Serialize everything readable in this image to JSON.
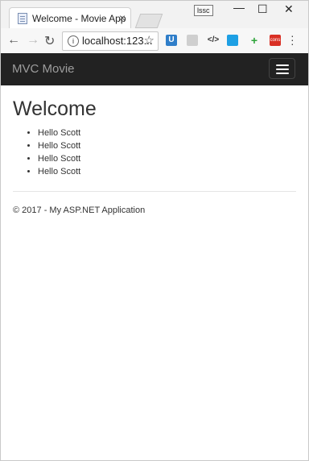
{
  "browser": {
    "tab_title": "Welcome - Movie App",
    "tab_close": "×",
    "user_badge": "lssc",
    "window_min": "—",
    "window_max": "☐",
    "window_close": "✕",
    "url": "localhost:123...",
    "info_glyph": "i",
    "star_glyph": "☆",
    "nav_back": "←",
    "nav_forward": "→",
    "nav_reload": "↻",
    "extensions": {
      "ext1": "U",
      "ext3": "</>",
      "ext5": "+",
      "ext6": "cons"
    }
  },
  "navbar": {
    "brand": "MVC Movie"
  },
  "main": {
    "heading": "Welcome",
    "items": [
      "Hello Scott",
      "Hello Scott",
      "Hello Scott",
      "Hello Scott"
    ]
  },
  "footer": {
    "text": "© 2017 - My ASP.NET Application"
  },
  "colors": {
    "navbar_bg": "#222222",
    "brand_text": "#9d9d9d",
    "body_text": "#333333"
  }
}
